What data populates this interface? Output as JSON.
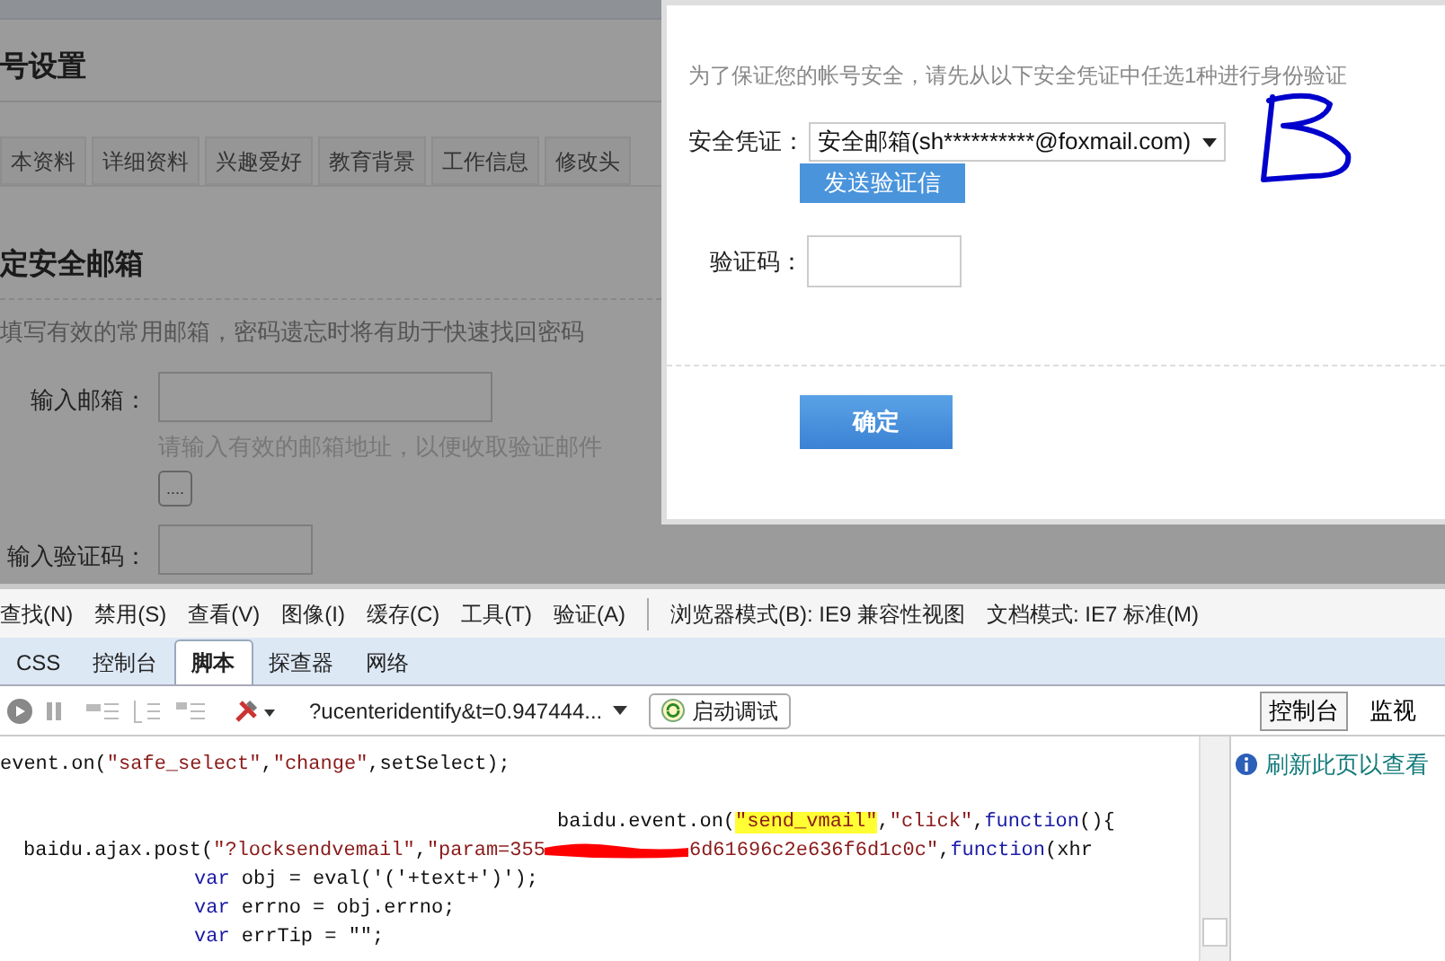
{
  "page": {
    "title": "号设置",
    "tabs": [
      "本资料",
      "详细资料",
      "兴趣爱好",
      "教育背景",
      "工作信息",
      "修改头"
    ],
    "section_title": "定安全邮箱",
    "hint": "填写有效的常用邮箱，密码遗忘时将有助于快速找回密码",
    "email_label": "输入邮箱：",
    "email_help": "请输入有效的邮箱地址，以便收取验证邮件",
    "email_button": "....",
    "captcha_label": "输入验证码："
  },
  "dialog": {
    "intro": "为了保证您的帐号安全，请先从以下安全凭证中任选1种进行身份验证",
    "credential_label": "安全凭证：",
    "credential_value": "安全邮箱(sh**********@foxmail.com)",
    "send_button": "发送验证信",
    "code_label": "验证码：",
    "confirm_button": "确定"
  },
  "devtools": {
    "menu": [
      "查找(N)",
      "禁用(S)",
      "查看(V)",
      "图像(I)",
      "缓存(C)",
      "工具(T)",
      "验证(A)"
    ],
    "modes": [
      "浏览器模式(B): IE9 兼容性视图",
      "文档模式: IE7 标准(M)"
    ],
    "tabs": [
      {
        "label": "CSS",
        "selected": false
      },
      {
        "label": "控制台",
        "selected": false
      },
      {
        "label": "脚本",
        "selected": true
      },
      {
        "label": "探查器",
        "selected": false
      },
      {
        "label": "网络",
        "selected": false
      }
    ],
    "script_select": "?ucenteridentify&t=0.947444...",
    "debug_button": "启动调试",
    "side_tabs": [
      {
        "label": "控制台",
        "selected": true
      },
      {
        "label": "监视",
        "selected": false
      }
    ],
    "console_message": "刷新此页以查看",
    "code_lines": [
      {
        "kind": "top",
        "tokens": [
          {
            "kind": "plain",
            "text": "event.on("
          },
          {
            "kind": "string",
            "text": "\"safe_select\""
          },
          {
            "kind": "plain",
            "text": ","
          },
          {
            "kind": "string",
            "text": "\"change\""
          },
          {
            "kind": "plain",
            "text": ",setSelect);"
          }
        ]
      },
      {
        "kind": "far",
        "tokens": [
          {
            "kind": "plain",
            "text": "baidu.event.on("
          },
          {
            "kind": "highlight",
            "text": "\"send_vmail\""
          },
          {
            "kind": "plain",
            "text": ","
          },
          {
            "kind": "string",
            "text": "\"click\""
          },
          {
            "kind": "plain",
            "text": ","
          },
          {
            "kind": "keyword",
            "text": "function"
          },
          {
            "kind": "plain",
            "text": "(){"
          }
        ]
      },
      {
        "kind": "near",
        "tokens": [
          {
            "kind": "plain",
            "text": "baidu.ajax.post("
          },
          {
            "kind": "string",
            "text": "\"?locksendvemail\""
          },
          {
            "kind": "plain",
            "text": ","
          },
          {
            "kind": "string",
            "text": "\"param=355"
          },
          {
            "kind": "redaction"
          },
          {
            "kind": "string",
            "text": "6d61696c2e636f6d1c0c\""
          },
          {
            "kind": "plain",
            "text": ","
          },
          {
            "kind": "keyword",
            "text": "function"
          },
          {
            "kind": "plain",
            "text": "(xhr"
          }
        ]
      },
      {
        "kind": "block",
        "tokens": [
          {
            "kind": "keyword",
            "text": "var"
          },
          {
            "kind": "plain",
            "text": " obj = eval('('+text+')');"
          }
        ]
      },
      {
        "kind": "block",
        "tokens": [
          {
            "kind": "keyword",
            "text": "var"
          },
          {
            "kind": "plain",
            "text": " errno = obj.errno;"
          }
        ]
      },
      {
        "kind": "block",
        "tokens": [
          {
            "kind": "keyword",
            "text": "var"
          },
          {
            "kind": "plain",
            "text": " errTip = \"\";"
          }
        ]
      }
    ]
  }
}
